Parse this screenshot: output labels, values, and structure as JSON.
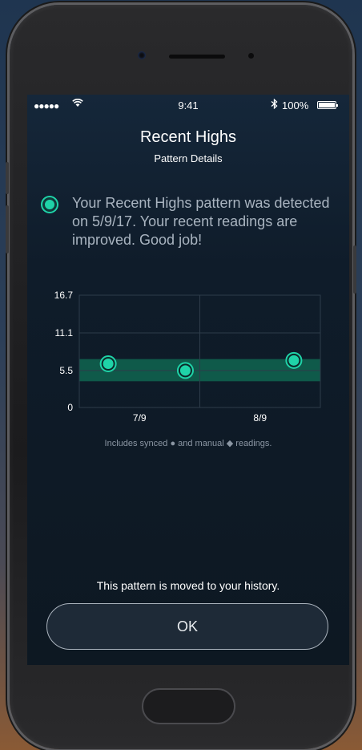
{
  "status_bar": {
    "signal": "●●●●●",
    "wifi_icon": "wifi-icon",
    "time": "9:41",
    "bluetooth_icon": "bluetooth-icon",
    "battery": "100%"
  },
  "header": {
    "title": "Recent Highs",
    "subtitle": "Pattern Details"
  },
  "info": {
    "text": "Your Recent Highs pattern was detected on 5/9/17. Your recent readings are improved. Good job!"
  },
  "chart_data": {
    "type": "scatter",
    "y_ticks": [
      "16.7",
      "11.1",
      "5.5",
      "0"
    ],
    "ylim": [
      0,
      16.7
    ],
    "x_ticks": [
      "7/9",
      "8/9"
    ],
    "target_range": [
      3.9,
      7.2
    ],
    "points": [
      {
        "x": 0.12,
        "y": 6.5
      },
      {
        "x": 0.44,
        "y": 5.5
      },
      {
        "x": 0.89,
        "y": 7.0
      }
    ],
    "grid": true,
    "colors": {
      "band": "#0f5a4a",
      "point": "#1fd3a8",
      "grid": "#2e3c4a"
    }
  },
  "chart_note": "Includes synced ● and manual ◆ readings.",
  "footer": {
    "history_text": "This pattern is moved to your history.",
    "ok_label": "OK"
  }
}
